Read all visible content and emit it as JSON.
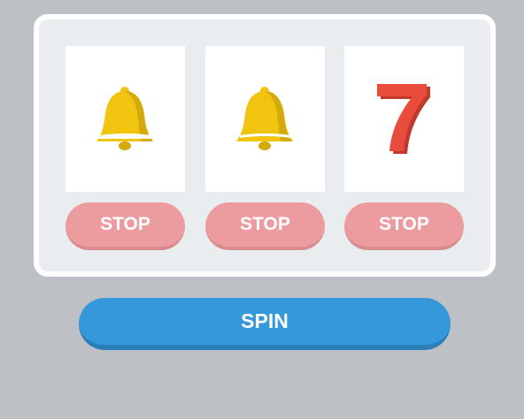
{
  "reels": [
    {
      "symbol": "bell-icon"
    },
    {
      "symbol": "bell-icon"
    },
    {
      "symbol": "seven-icon"
    }
  ],
  "stop_buttons": [
    {
      "label": "STOP"
    },
    {
      "label": "STOP"
    },
    {
      "label": "STOP"
    }
  ],
  "spin": {
    "label": "SPIN"
  },
  "colors": {
    "background": "#bdc1c5",
    "machine": "#e9edef",
    "reel": "#ffffff",
    "stop": "#ec9b9e",
    "spin": "#3498db",
    "bell": "#f1c40f",
    "seven": "#e74c3c"
  }
}
